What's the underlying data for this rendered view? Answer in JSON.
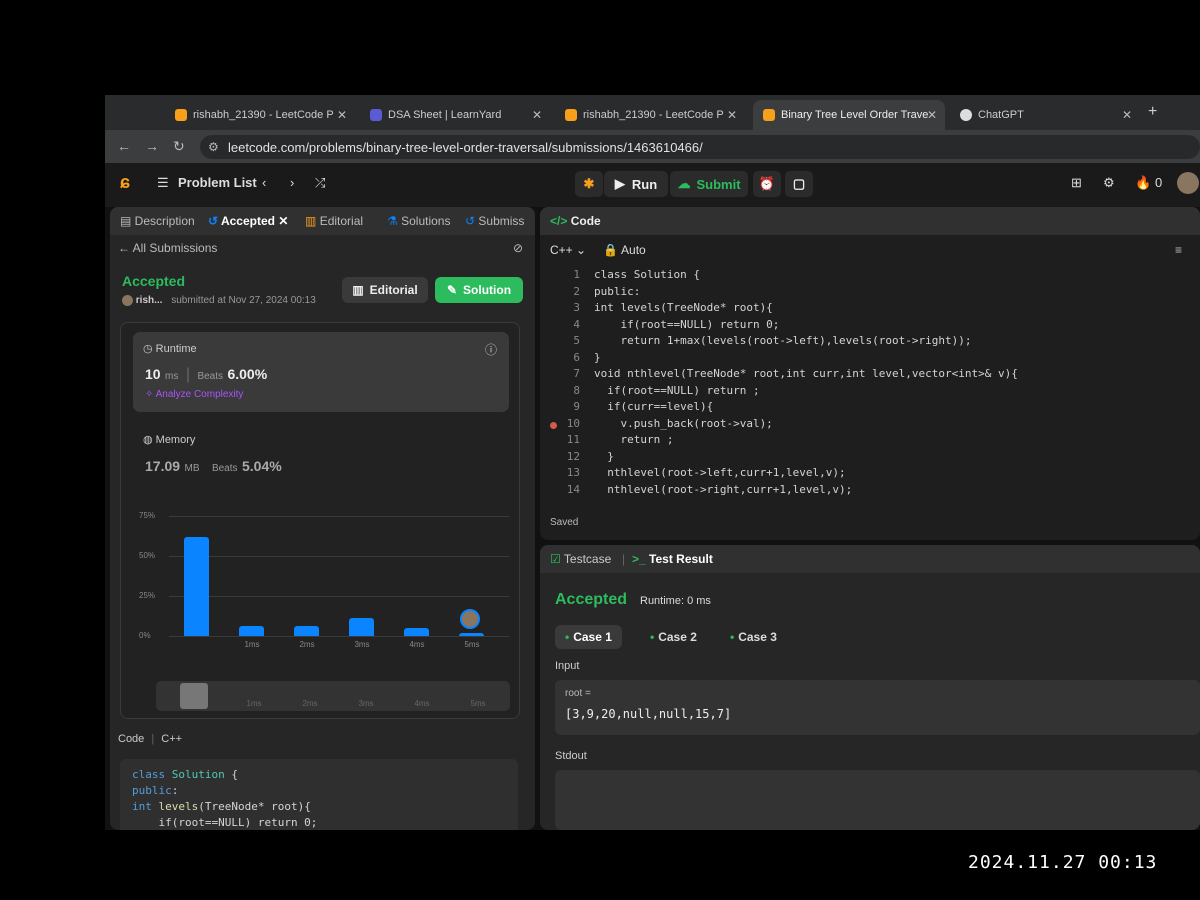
{
  "browser": {
    "tabs": [
      {
        "label": "rishabh_21390 - LeetCode P",
        "active": false
      },
      {
        "label": "DSA Sheet | LearnYard",
        "active": false
      },
      {
        "label": "rishabh_21390 - LeetCode P",
        "active": false
      },
      {
        "label": "Binary Tree Level Order Trave",
        "active": true
      },
      {
        "label": "ChatGPT",
        "active": false
      }
    ],
    "url": "leetcode.com/problems/binary-tree-level-order-traversal/submissions/1463610466/"
  },
  "lc_nav": {
    "problem_list": "Problem List",
    "run": "Run",
    "submit": "Submit",
    "streak": "0"
  },
  "left_panel": {
    "tabs": [
      "Description",
      "Accepted",
      "Editorial",
      "Solutions",
      "Submiss"
    ],
    "all_submissions": "All Submissions",
    "status": "Accepted",
    "user": "rish...",
    "submitted": "submitted at Nov 27, 2024 00:13",
    "editorial_btn": "Editorial",
    "solution_btn": "Solution",
    "runtime": {
      "label": "Runtime",
      "value": "10",
      "unit": "ms",
      "beats_label": "Beats",
      "beats": "6.00%",
      "analyze": "Analyze Complexity"
    },
    "memory": {
      "label": "Memory",
      "value": "17.09",
      "unit": "MB",
      "beats_label": "Beats",
      "beats": "5.04%"
    },
    "code_header": "Code",
    "code_lang": "C++",
    "code_preview": [
      "class Solution {",
      "public:",
      "int levels(TreeNode* root){",
      "    if(root==NULL) return 0;"
    ]
  },
  "chart_data": {
    "type": "bar",
    "categories": [
      "",
      "1ms",
      "2ms",
      "3ms",
      "4ms",
      "5ms"
    ],
    "values": [
      62,
      6,
      6,
      11,
      5,
      2
    ],
    "yticks": [
      "75%",
      "50%",
      "25%",
      "0%"
    ],
    "ylim": [
      0,
      75
    ],
    "xlabel": "",
    "ylabel": ""
  },
  "editor": {
    "title": "Code",
    "language": "C++",
    "mode": "Auto",
    "lines": [
      {
        "n": "1",
        "t": "class Solution {"
      },
      {
        "n": "2",
        "t": "public:"
      },
      {
        "n": "3",
        "t": "int levels(TreeNode* root){"
      },
      {
        "n": "4",
        "t": "    if(root==NULL) return 0;"
      },
      {
        "n": "5",
        "t": "    return 1+max(levels(root->left),levels(root->right));"
      },
      {
        "n": "6",
        "t": "}"
      },
      {
        "n": "7",
        "t": "void nthlevel(TreeNode* root,int curr,int level,vector<int>& v){"
      },
      {
        "n": "8",
        "t": "  if(root==NULL) return ;"
      },
      {
        "n": "9",
        "t": "  if(curr==level){"
      },
      {
        "n": "10",
        "t": "    v.push_back(root->val);"
      },
      {
        "n": "11",
        "t": "    return ;"
      },
      {
        "n": "12",
        "t": "  }"
      },
      {
        "n": "13",
        "t": "  nthlevel(root->left,curr+1,level,v);"
      },
      {
        "n": "14",
        "t": "  nthlevel(root->right,curr+1,level,v);"
      }
    ],
    "saved": "Saved"
  },
  "test": {
    "tab_testcase": "Testcase",
    "tab_result": "Test Result",
    "status": "Accepted",
    "runtime": "Runtime: 0 ms",
    "cases": [
      "Case 1",
      "Case 2",
      "Case 3"
    ],
    "input_label": "Input",
    "input_var": "root =",
    "input_value": "[3,9,20,null,null,15,7]",
    "stdout_label": "Stdout"
  },
  "photo_timestamp": "2024.11.27 00:13"
}
